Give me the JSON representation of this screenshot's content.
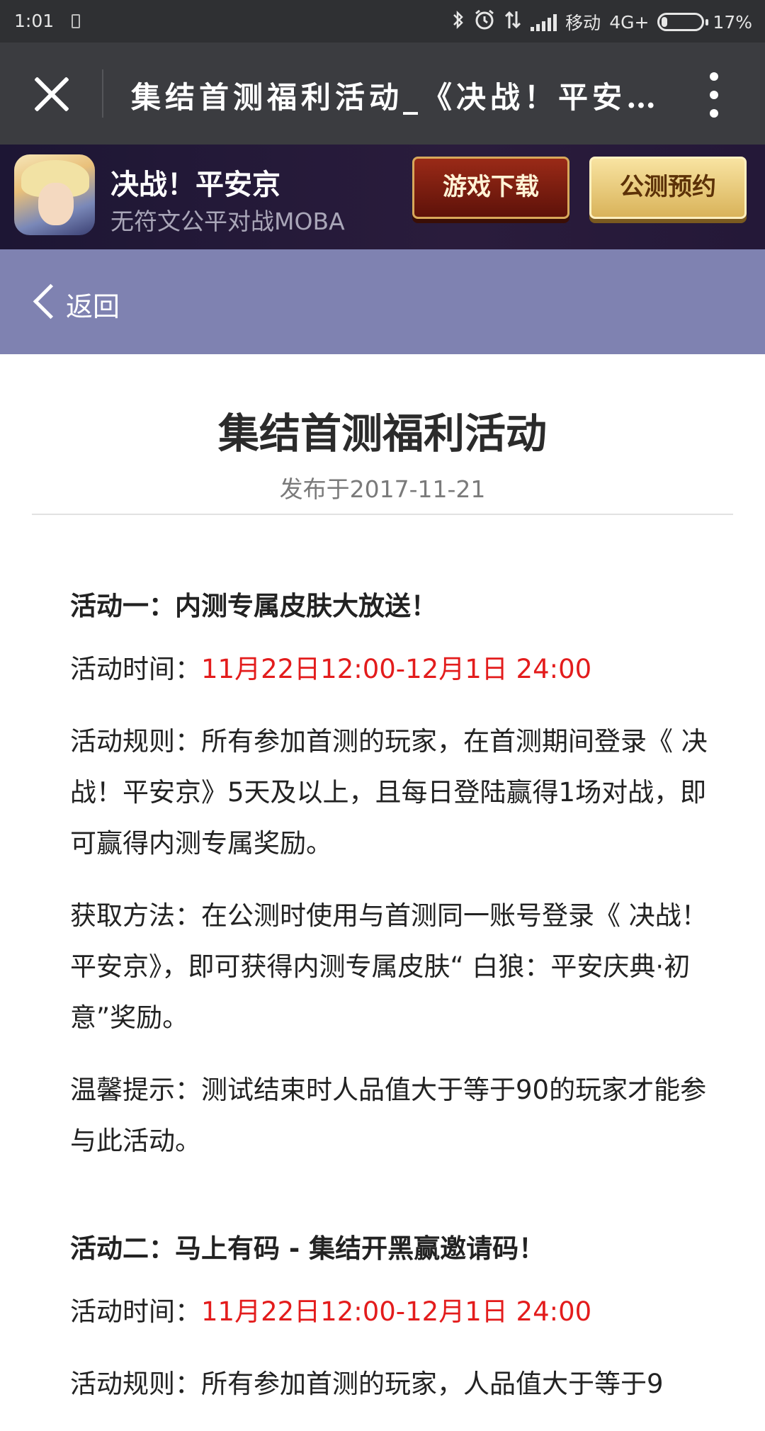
{
  "status_bar": {
    "time": "1:01",
    "carrier": "移动",
    "network": "4G+",
    "battery": "17%",
    "battery_level_percent": 17,
    "icons": [
      "bluetooth-icon",
      "alarm-icon",
      "data-arrows-icon",
      "signal-icon"
    ]
  },
  "title_bar": {
    "title": "集结首测福利活动_《决战！平安…",
    "close_icon": "close-icon",
    "more_icon": "more-vertical-icon"
  },
  "banner": {
    "game_name": "决战！平安京",
    "game_sub": "无符文公平对战MOBA",
    "download_label": "游戏下载",
    "reserve_label": "公测预约"
  },
  "back": {
    "label": "返回"
  },
  "article": {
    "title": "集结首测福利活动",
    "date": "发布于2017-11-21",
    "sections": [
      {
        "heading": "活动一：内测专属皮肤大放送！",
        "time_label": "活动时间：",
        "time_value": "11月22日12:00-12月1日 24:00",
        "rules": "活动规则：所有参加首测的玩家，在首测期间登录《 决战！平安京》5天及以上，且每日登陆赢得1场对战，即可赢得内测专属奖励。",
        "method": "获取方法：在公测时使用与首测同一账号登录《 决战！平安京》，即可获得内测专属皮肤“ 白狼：平安庆典·初意”奖励。",
        "tip": "温馨提示：测试结束时人品值大于等于90的玩家才能参与此活动。"
      },
      {
        "heading": "活动二：马上有码 - 集结开黑赢邀请码！",
        "time_label": "活动时间：",
        "time_value": "11月22日12:00-12月1日 24:00",
        "rules": "活动规则：所有参加首测的玩家，人品值大于等于9"
      }
    ]
  }
}
